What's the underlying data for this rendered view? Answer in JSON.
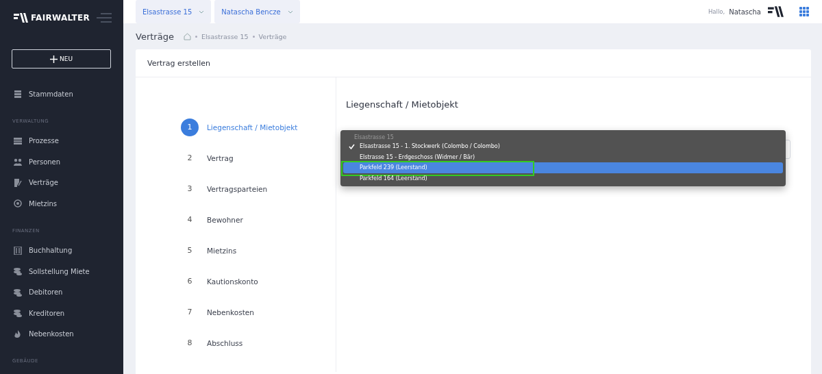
{
  "sidebar": {
    "brand": "FAIRWALTER",
    "new_button": "NEU",
    "items": [
      {
        "kind": "item",
        "label": "Stammdaten"
      },
      {
        "kind": "section",
        "label": "VERWALTUNG"
      },
      {
        "kind": "item",
        "label": "Prozesse"
      },
      {
        "kind": "item",
        "label": "Personen"
      },
      {
        "kind": "item",
        "label": "Verträge"
      },
      {
        "kind": "item",
        "label": "Mietzins"
      },
      {
        "kind": "section",
        "label": "FINANZEN"
      },
      {
        "kind": "item",
        "label": "Buchhaltung"
      },
      {
        "kind": "item",
        "label": "Sollstellung Miete"
      },
      {
        "kind": "item",
        "label": "Debitoren"
      },
      {
        "kind": "item",
        "label": "Kreditoren"
      },
      {
        "kind": "item",
        "label": "Nebenkosten"
      },
      {
        "kind": "section",
        "label": "GEBÄUDE"
      }
    ]
  },
  "topbar": {
    "selectors": [
      "Elsastrasse 15",
      "Natascha Bencze"
    ],
    "greeting": "Hallo,",
    "user": "Natascha"
  },
  "page": {
    "title": "Verträge",
    "breadcrumb": [
      "Elsastrasse 15",
      "Verträge"
    ]
  },
  "card": {
    "title": "Vertrag erstellen",
    "steps": [
      {
        "number": "1",
        "label": "Liegenschaft / Mietobjekt",
        "selected": true
      },
      {
        "number": "2",
        "label": "Vertrag",
        "selected": false
      },
      {
        "number": "3",
        "label": "Vertragsparteien",
        "selected": false
      },
      {
        "number": "4",
        "label": "Bewohner",
        "selected": false
      },
      {
        "number": "5",
        "label": "Mietzins",
        "selected": false
      },
      {
        "number": "6",
        "label": "Kautionskonto",
        "selected": false
      },
      {
        "number": "7",
        "label": "Nebenkosten",
        "selected": false
      },
      {
        "number": "8",
        "label": "Abschluss",
        "selected": false
      }
    ],
    "section_title": "Liegenschaft / Mietobjekt",
    "dropdown": {
      "group": "Elsastrasse 15",
      "options": [
        {
          "label": "Elsastrasse 15 - 1. Stockwerk (Colombo / Colombo)",
          "checked": true,
          "selected": false
        },
        {
          "label": "Elstrasse 15 - Erdgeschoss (Widmer / Bär)",
          "checked": false,
          "selected": false
        },
        {
          "label": "Parkfeld 239 (Leerstand)",
          "checked": false,
          "selected": true
        },
        {
          "label": "Parkfeld 164 (Leerstand)",
          "checked": false,
          "selected": false
        }
      ]
    }
  }
}
